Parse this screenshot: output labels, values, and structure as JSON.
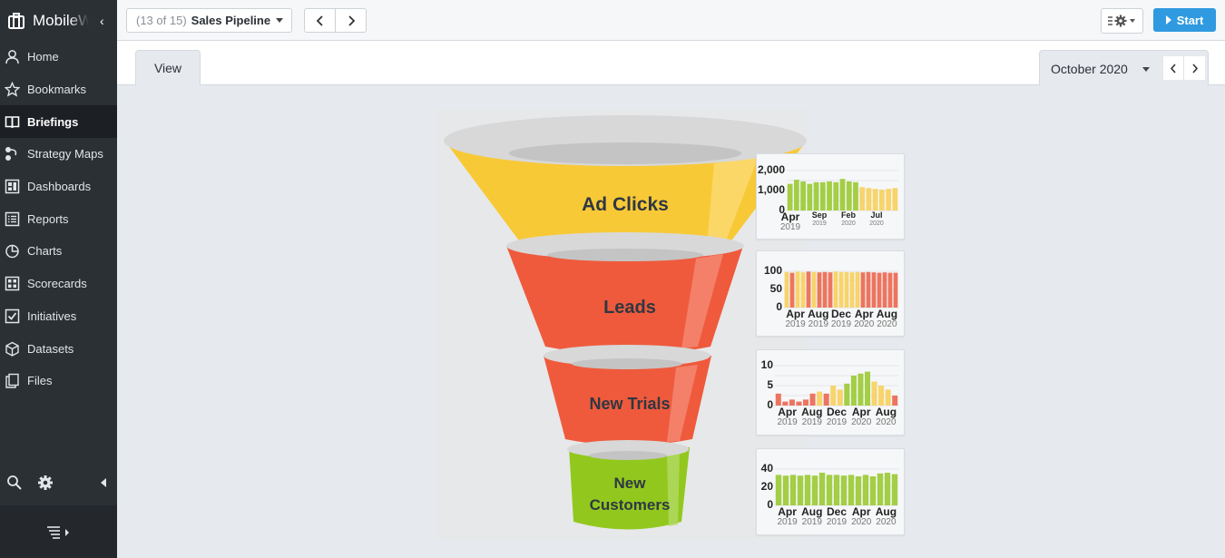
{
  "app": {
    "name": "MobileWorks"
  },
  "sidebar": {
    "items": [
      {
        "label": "Home",
        "icon": "user-icon"
      },
      {
        "label": "Bookmarks",
        "icon": "star-icon"
      },
      {
        "label": "Briefings",
        "icon": "book-icon",
        "active": true
      },
      {
        "label": "Strategy Maps",
        "icon": "strategy-map-icon"
      },
      {
        "label": "Dashboards",
        "icon": "dashboard-icon"
      },
      {
        "label": "Reports",
        "icon": "report-icon"
      },
      {
        "label": "Charts",
        "icon": "pie-chart-icon"
      },
      {
        "label": "Scorecards",
        "icon": "scorecard-icon"
      },
      {
        "label": "Initiatives",
        "icon": "checkbox-icon"
      },
      {
        "label": "Datasets",
        "icon": "cube-icon"
      },
      {
        "label": "Files",
        "icon": "files-icon"
      }
    ]
  },
  "toolbar": {
    "briefing_count": "(13 of 15)",
    "briefing_title": "Sales Pipeline",
    "start_label": "Start"
  },
  "tabs": {
    "view_label": "View"
  },
  "period": {
    "label": "October 2020"
  },
  "funnel": {
    "stages": [
      "Ad Clicks",
      "Leads",
      "New Trials",
      "New Customers"
    ],
    "colors": [
      "#f8c936",
      "#ef5a3c",
      "#ef5a3c",
      "#92c81e"
    ]
  },
  "chart_data": [
    {
      "type": "bar",
      "name": "Ad Clicks",
      "y_ticks": [
        "2,000",
        "1,000",
        "0"
      ],
      "ylim": [
        0,
        2400
      ],
      "x_ticks": [
        {
          "m": "Apr",
          "y": "2019"
        },
        {
          "m": "Sep",
          "y": "2019"
        },
        {
          "m": "Feb",
          "y": "2020"
        },
        {
          "m": "Jul",
          "y": "2020"
        }
      ],
      "values": [
        1600,
        1850,
        1750,
        1600,
        1700,
        1700,
        1750,
        1700,
        1900,
        1750,
        1700,
        1400,
        1350,
        1300,
        1250,
        1300,
        1350
      ],
      "status": [
        "g",
        "g",
        "g",
        "g",
        "g",
        "g",
        "g",
        "g",
        "g",
        "g",
        "g",
        "y",
        "y",
        "y",
        "y",
        "y",
        "y"
      ]
    },
    {
      "type": "bar",
      "name": "Leads",
      "y_ticks": [
        "100",
        "50",
        "0"
      ],
      "ylim": [
        0,
        100
      ],
      "x_ticks": [
        {
          "m": "Apr",
          "y": "2019"
        },
        {
          "m": "Aug",
          "y": "2019"
        },
        {
          "m": "Dec",
          "y": "2019"
        },
        {
          "m": "Apr",
          "y": "2020"
        },
        {
          "m": "Aug",
          "y": "2020"
        }
      ],
      "values": [
        98,
        96,
        99,
        97,
        99,
        98,
        97,
        98,
        97,
        99,
        98,
        98,
        97,
        98,
        97,
        98,
        97,
        96,
        97,
        96,
        96
      ],
      "status": [
        "y",
        "r",
        "y",
        "y",
        "r",
        "y",
        "r",
        "r",
        "r",
        "y",
        "y",
        "y",
        "y",
        "y",
        "r",
        "r",
        "r",
        "r",
        "r",
        "r",
        "r"
      ]
    },
    {
      "type": "bar",
      "name": "New Trials",
      "y_ticks": [
        "10",
        "5",
        "0"
      ],
      "ylim": [
        0,
        10
      ],
      "x_ticks": [
        {
          "m": "Apr",
          "y": "2019"
        },
        {
          "m": "Aug",
          "y": "2019"
        },
        {
          "m": "Dec",
          "y": "2019"
        },
        {
          "m": "Apr",
          "y": "2020"
        },
        {
          "m": "Aug",
          "y": "2020"
        }
      ],
      "values": [
        3,
        1,
        1.5,
        1,
        1.5,
        3,
        3.5,
        3,
        5,
        4,
        5.5,
        7.5,
        8,
        8.5,
        6,
        5,
        4,
        2.5
      ],
      "status": [
        "r",
        "r",
        "r",
        "r",
        "r",
        "r",
        "y",
        "r",
        "y",
        "y",
        "g",
        "g",
        "g",
        "g",
        "y",
        "y",
        "y",
        "r"
      ]
    },
    {
      "type": "bar",
      "name": "New Customers",
      "y_ticks": [
        "40",
        "20",
        "0"
      ],
      "ylim": [
        0,
        50
      ],
      "x_ticks": [
        {
          "m": "Apr",
          "y": "2019"
        },
        {
          "m": "Aug",
          "y": "2019"
        },
        {
          "m": "Dec",
          "y": "2019"
        },
        {
          "m": "Apr",
          "y": "2020"
        },
        {
          "m": "Aug",
          "y": "2020"
        }
      ],
      "values": [
        42,
        41,
        42,
        41,
        42,
        41,
        45,
        42,
        42,
        41,
        42,
        40,
        42,
        40,
        44,
        45,
        43
      ],
      "status": [
        "g",
        "g",
        "g",
        "g",
        "g",
        "g",
        "g",
        "g",
        "g",
        "g",
        "g",
        "g",
        "g",
        "g",
        "g",
        "g",
        "g"
      ]
    }
  ],
  "status_colors": {
    "g": "#a3ce45",
    "y": "#f7d46c",
    "r": "#ec7560"
  }
}
